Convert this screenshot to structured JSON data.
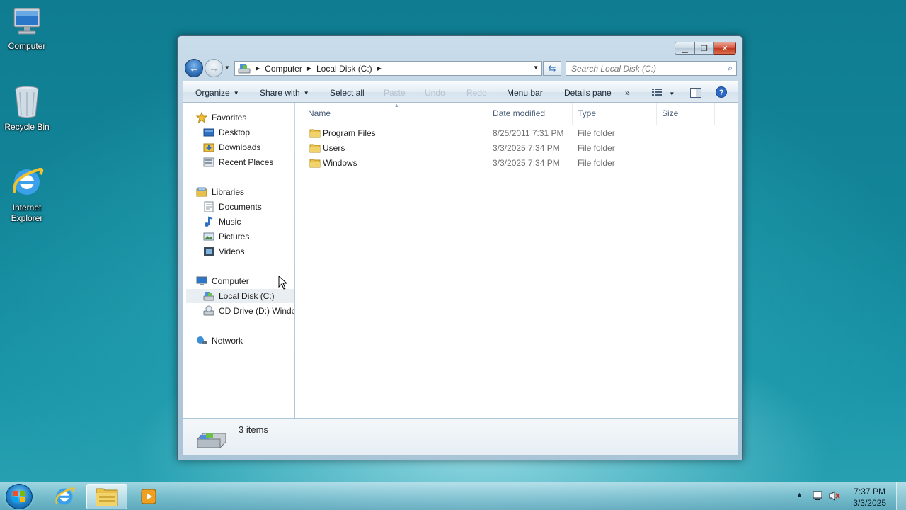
{
  "desktop": {
    "icons": [
      {
        "label": "Computer",
        "icon": "computer-icon"
      },
      {
        "label": "Recycle Bin",
        "icon": "recycle-bin-icon"
      },
      {
        "label_line1": "Internet",
        "label_line2": "Explorer",
        "icon": "internet-explorer-icon"
      }
    ]
  },
  "window": {
    "address": {
      "crumbs": [
        "Computer",
        "Local Disk (C:)"
      ]
    },
    "search_placeholder": "Search Local Disk (C:)",
    "toolbar": {
      "organize": "Organize",
      "share_with": "Share with",
      "select_all": "Select all",
      "paste": "Paste",
      "undo": "Undo",
      "redo": "Redo",
      "menu_bar": "Menu bar",
      "details_pane": "Details pane",
      "more": "»"
    },
    "nav": {
      "favorites": "Favorites",
      "desktop": "Desktop",
      "downloads": "Downloads",
      "recent_places": "Recent Places",
      "libraries": "Libraries",
      "documents": "Documents",
      "music": "Music",
      "pictures": "Pictures",
      "videos": "Videos",
      "computer": "Computer",
      "local_disk": "Local Disk (C:)",
      "cd_drive": "CD Drive (D:) Windo",
      "network": "Network"
    },
    "columns": {
      "name": "Name",
      "date_modified": "Date modified",
      "type": "Type",
      "size": "Size"
    },
    "files": [
      {
        "name": "Program Files",
        "date": "8/25/2011 7:31 PM",
        "type": "File folder"
      },
      {
        "name": "Users",
        "date": "3/3/2025 7:34 PM",
        "type": "File folder"
      },
      {
        "name": "Windows",
        "date": "3/3/2025 7:34 PM",
        "type": "File folder"
      }
    ],
    "details": {
      "count": "3 items"
    }
  },
  "taskbar": {
    "time": "7:37 PM",
    "date": "3/3/2025"
  },
  "colors": {
    "accent": "#2f6fb8",
    "folder": "#e8c04a"
  }
}
